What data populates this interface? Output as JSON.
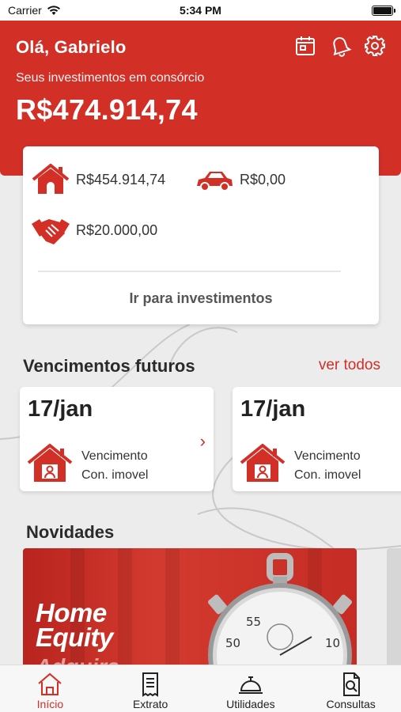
{
  "status_bar": {
    "carrier": "Carrier",
    "time": "5:34 PM"
  },
  "header": {
    "greeting": "Olá, Gabrielo",
    "subtitle": "Seus investimentos em consórcio",
    "total": "R$474.914,74",
    "icons": [
      "calendar-icon",
      "bell-icon",
      "gear-icon"
    ]
  },
  "summary": {
    "items": [
      {
        "icon": "house-icon",
        "value": "R$454.914,74"
      },
      {
        "icon": "car-icon",
        "value": "R$0,00"
      },
      {
        "icon": "handshake-icon",
        "value": "R$20.000,00"
      }
    ],
    "link": "Ir para investimentos"
  },
  "vencimentos": {
    "title": "Vencimentos futuros",
    "see_all": "ver todos",
    "cards": [
      {
        "date": "17/jan",
        "line1": "Vencimento",
        "line2": "Con. imovel"
      },
      {
        "date": "17/jan",
        "line1": "Vencimento",
        "line2": "Con. imovel"
      }
    ]
  },
  "novidades": {
    "title": "Novidades",
    "banner_title_1": "Home",
    "banner_title_2": "Equity",
    "banner_sub": "Adquira"
  },
  "tabbar": {
    "tabs": [
      {
        "label": "Início",
        "icon": "home-icon",
        "active": true
      },
      {
        "label": "Extrato",
        "icon": "receipt-icon",
        "active": false
      },
      {
        "label": "Utilidades",
        "icon": "service-bell-icon",
        "active": false
      },
      {
        "label": "Consultas",
        "icon": "document-search-icon",
        "active": false
      }
    ]
  },
  "colors": {
    "brand_red": "#d22f27",
    "background": "#ececec"
  }
}
